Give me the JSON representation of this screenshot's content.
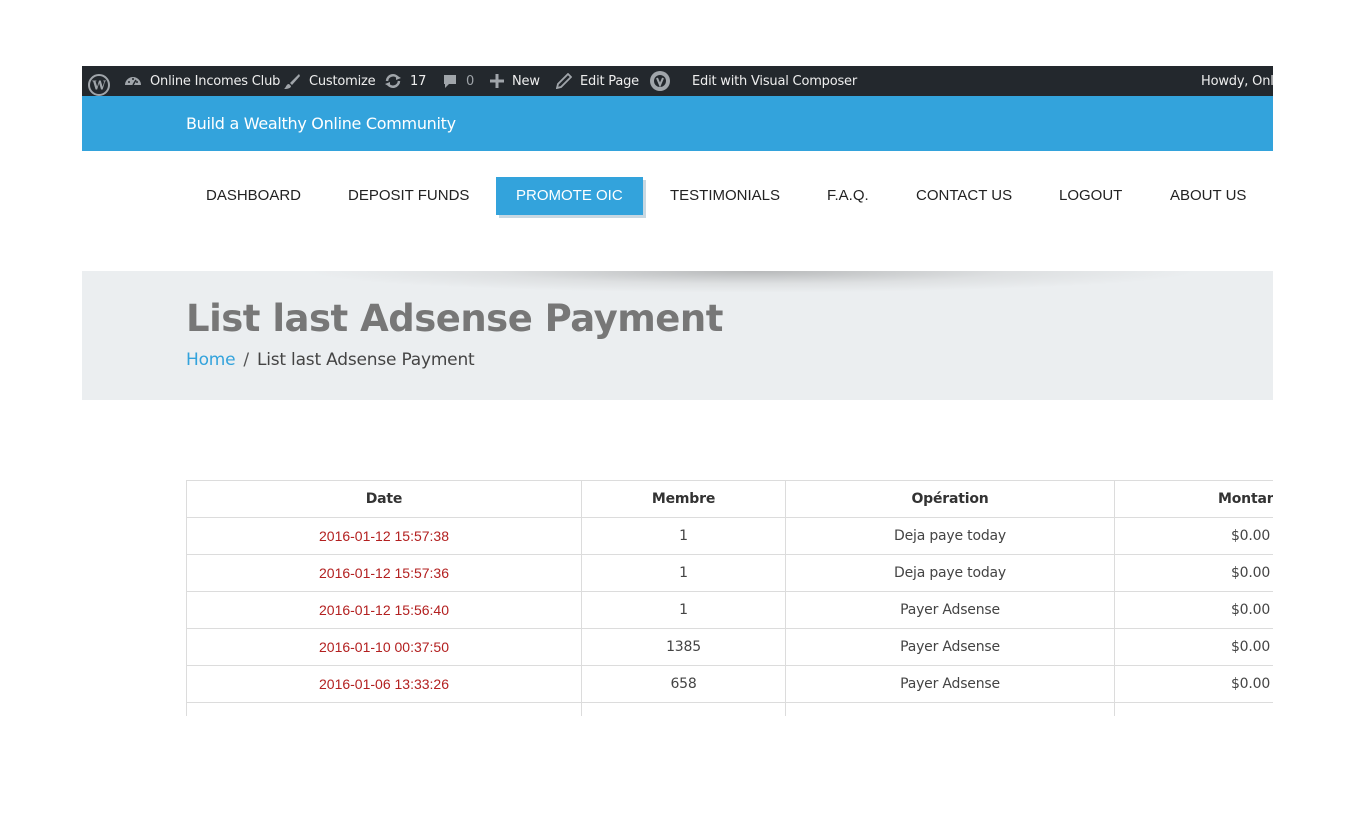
{
  "adminbar": {
    "site_name": "Online Incomes Club",
    "customize": "Customize",
    "updates_count": "17",
    "comments_count": "0",
    "new_label": "New",
    "edit_page": "Edit Page",
    "visual_composer": "Edit with Visual Composer",
    "howdy": "Howdy, Onli"
  },
  "header": {
    "tagline": "Build a Wealthy Online Community"
  },
  "nav": {
    "items": [
      {
        "label": "DASHBOARD"
      },
      {
        "label": "DEPOSIT FUNDS"
      },
      {
        "label": "PROMOTE OIC"
      },
      {
        "label": "TESTIMONIALS"
      },
      {
        "label": "F.A.Q."
      },
      {
        "label": "CONTACT US"
      },
      {
        "label": "LOGOUT"
      },
      {
        "label": "ABOUT US"
      }
    ],
    "active": "PROMOTE OIC"
  },
  "page": {
    "title": "List last Adsense Payment",
    "breadcrumb_home": "Home",
    "breadcrumb_sep": "/",
    "breadcrumb_current": "List last Adsense Payment"
  },
  "table": {
    "headers": [
      "Date",
      "Membre",
      "Opération",
      "Montant"
    ],
    "rows": [
      {
        "date": "2016-01-12 15:57:38",
        "membre": "1",
        "operation": "Deja paye today",
        "montant": "$0.00"
      },
      {
        "date": "2016-01-12 15:57:36",
        "membre": "1",
        "operation": "Deja paye today",
        "montant": "$0.00"
      },
      {
        "date": "2016-01-12 15:56:40",
        "membre": "1",
        "operation": "Payer Adsense",
        "montant": "$0.00"
      },
      {
        "date": "2016-01-10 00:37:50",
        "membre": "1385",
        "operation": "Payer Adsense",
        "montant": "$0.00"
      },
      {
        "date": "2016-01-06 13:33:26",
        "membre": "658",
        "operation": "Payer Adsense",
        "montant": "$0.00"
      }
    ]
  },
  "colors": {
    "adminbar_bg": "#23282d",
    "accent_blue": "#33a3dc",
    "date_red": "#b32020",
    "title_band": "#ebeef0"
  },
  "icons": [
    "wordpress-icon",
    "dashboard-gauge-icon",
    "paintbrush-icon",
    "refresh-icon",
    "comment-icon",
    "plus-icon",
    "pencil-icon",
    "visual-composer-icon"
  ]
}
